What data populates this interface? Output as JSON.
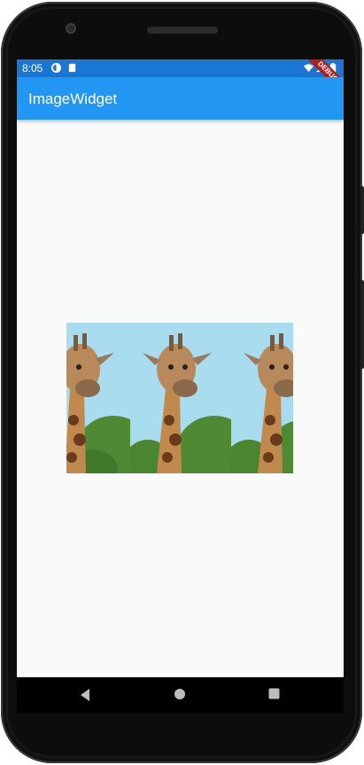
{
  "status_bar": {
    "time": "8:05",
    "icons": [
      "data-saver-icon",
      "sd-card-icon",
      "wifi-icon",
      "signal-icon",
      "battery-icon"
    ]
  },
  "app_bar": {
    "title": "ImageWidget"
  },
  "debug_banner": {
    "label": "DEBUG"
  },
  "image": {
    "subject": "giraffe",
    "repeat": "horizontal",
    "tiles": 3
  },
  "nav_bar": {
    "buttons": [
      "back-icon",
      "home-icon",
      "recents-icon"
    ]
  },
  "colors": {
    "status_bar": "#1976d2",
    "app_bar": "#2196f3",
    "background": "#fafafa",
    "debug_banner": "#b71c1c"
  }
}
